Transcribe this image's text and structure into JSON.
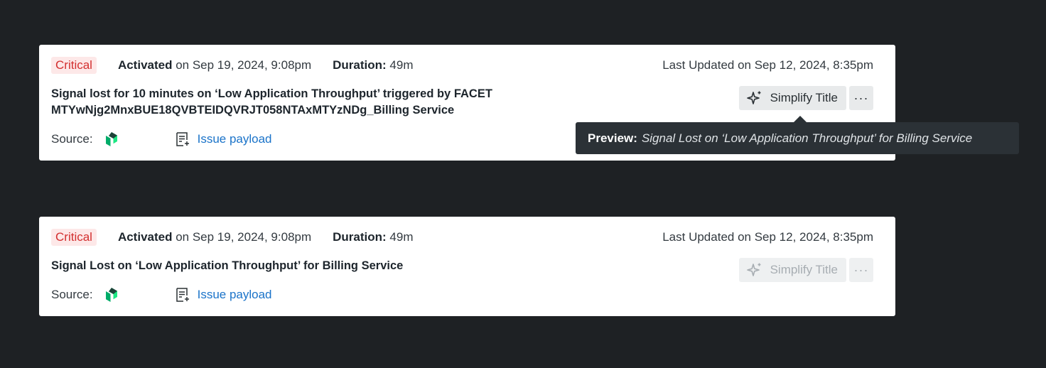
{
  "cards": [
    {
      "severity": "Critical",
      "activated_label": "Activated",
      "activated_value": " on Sep 19, 2024, 9:08pm",
      "duration_label": "Duration:",
      "duration_value": " 49m",
      "last_updated": "Last Updated on Sep 12, 2024, 8:35pm",
      "title_line1": "Signal lost for 10 minutes on ‘Low Application Throughput’ triggered by FACET",
      "title_line2": "MTYwNjg2MnxBUE18QVBTEIDQVRJT058NTAxMTYzNDg_Billing Service",
      "source_label": "Source:",
      "payload_label": "Issue payload",
      "simplify_label": "Simplify Title",
      "more_label": "···"
    },
    {
      "severity": "Critical",
      "activated_label": "Activated",
      "activated_value": " on Sep 19, 2024, 9:08pm",
      "duration_label": "Duration:",
      "duration_value": " 49m",
      "last_updated": "Last Updated on Sep 12, 2024, 8:35pm",
      "title_line1": "Signal Lost on ‘Low Application Throughput’ for Billing Service",
      "source_label": "Source:",
      "payload_label": "Issue payload",
      "simplify_label": "Simplify Title",
      "more_label": "···"
    }
  ],
  "tooltip": {
    "label": "Preview:",
    "text": "Signal Lost on ‘Low Application Throughput’ for Billing Service"
  },
  "icons": {
    "source": "new-relic-logo-icon",
    "payload": "document-add-icon",
    "simplify": "sparkle-icon"
  },
  "colors": {
    "critical_text": "#d32f2f",
    "critical_bg": "#fde8e8",
    "link": "#1a73c9",
    "background": "#1e2124",
    "tooltip_bg": "#2b3136"
  }
}
